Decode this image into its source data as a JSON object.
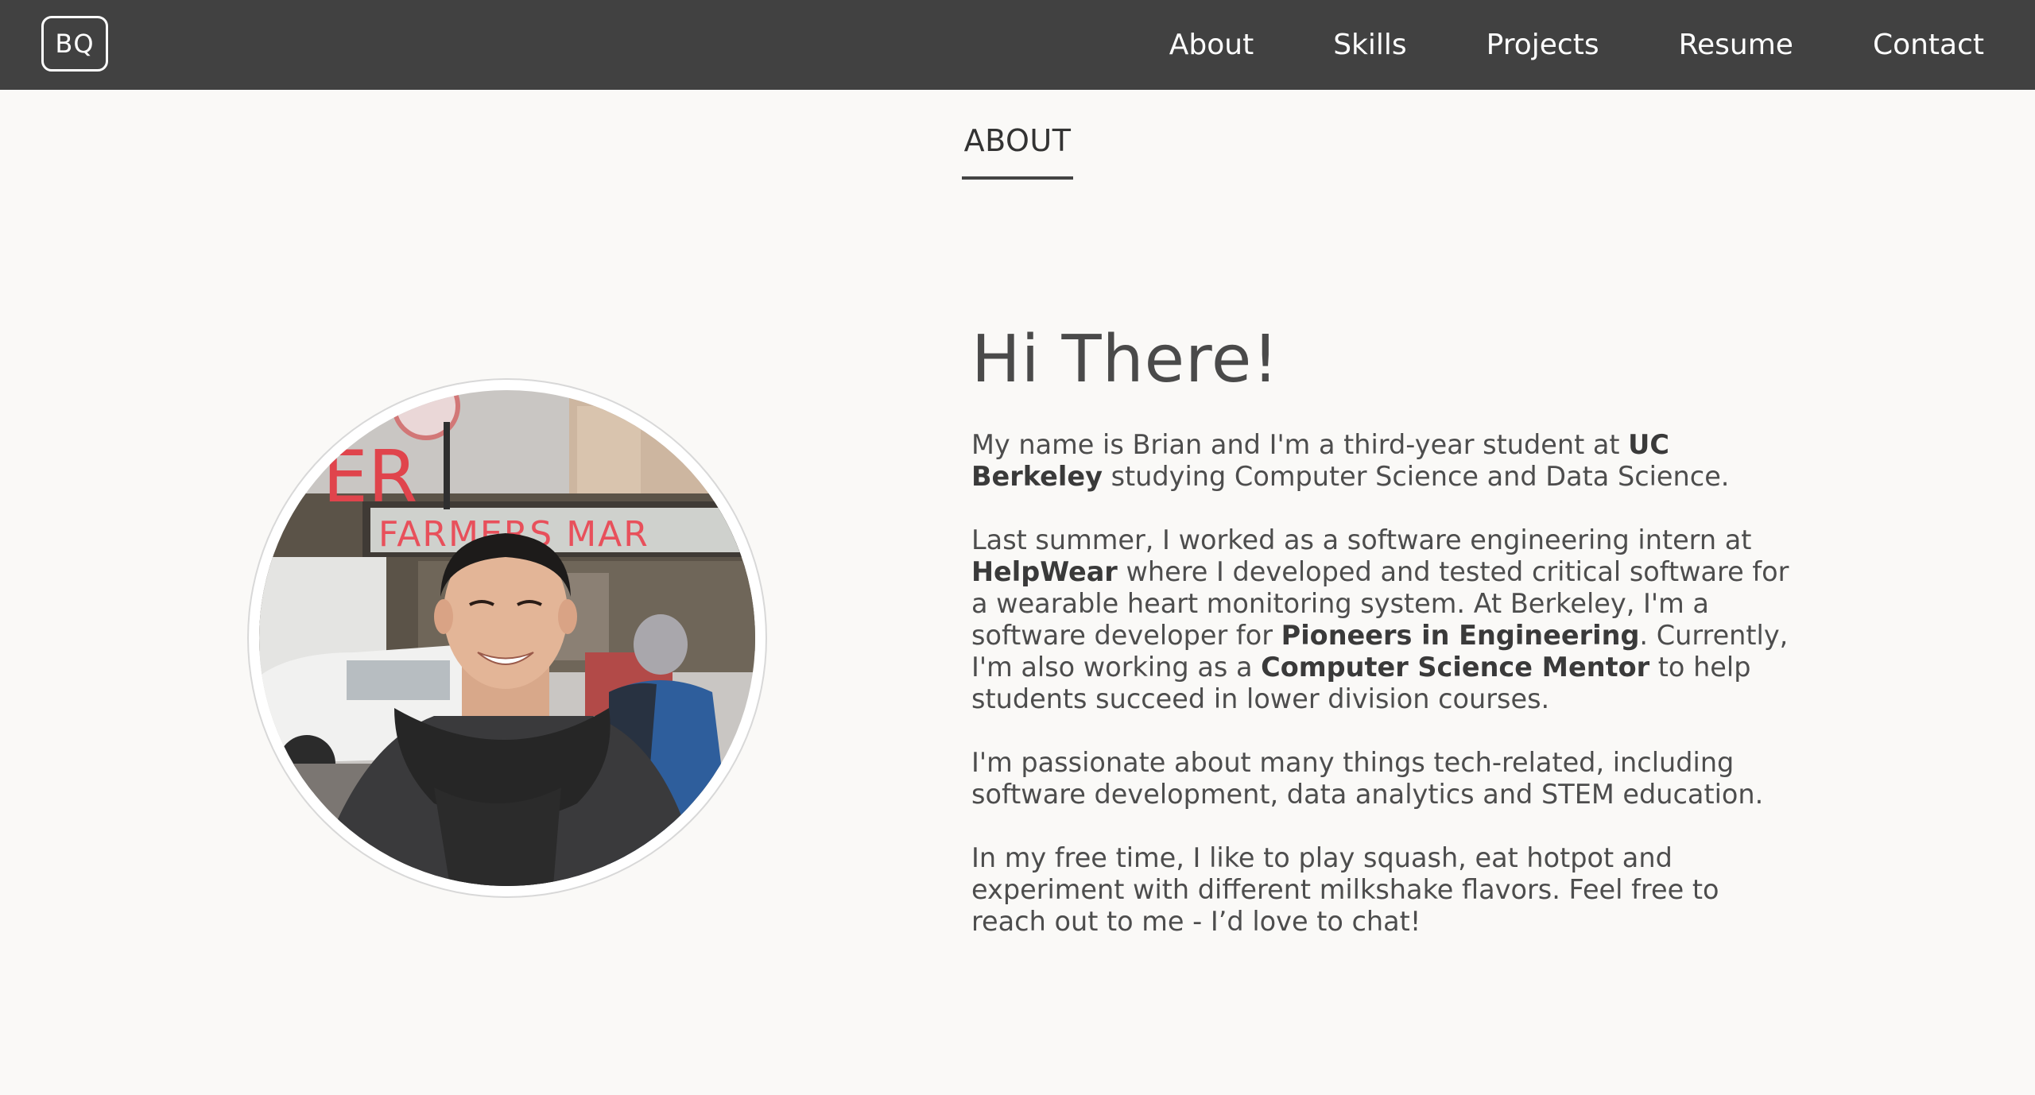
{
  "nav": {
    "logo": "BQ",
    "links": [
      "About",
      "Skills",
      "Projects",
      "Resume",
      "Contact"
    ]
  },
  "section": {
    "title": "ABOUT"
  },
  "about": {
    "greeting": "Hi There!",
    "p1": {
      "t1": "My name is Brian and I'm a third-year student at ",
      "b1": "UC Berkeley",
      "t2": " studying Computer Science and Data Science."
    },
    "p2": {
      "t1": "Last summer, I worked as a software engineering intern at ",
      "b1": "HelpWear",
      "t2": " where I developed and tested critical software for a wearable heart monitoring system. At Berkeley, I'm a software developer for ",
      "b2": "Pioneers in Engineering",
      "t3": ". Currently, I'm also working as a ",
      "b3": "Computer Science Mentor",
      "t4": " to help students succeed in lower division courses."
    },
    "p3": "I'm passionate about many things tech-related, including software development, data analytics and STEM education.",
    "p4": "In my free time, I like to play squash, eat hotpot and experiment with different milkshake flavors. Feel free to reach out to me - I’d love to chat!",
    "photo_sign": "FARMERS MAR",
    "photo_sign2": "ER"
  },
  "colors": {
    "navbar": "#414141",
    "background": "#faf9f7",
    "text": "#4d4d4d",
    "sign_red": "#e8505b"
  }
}
